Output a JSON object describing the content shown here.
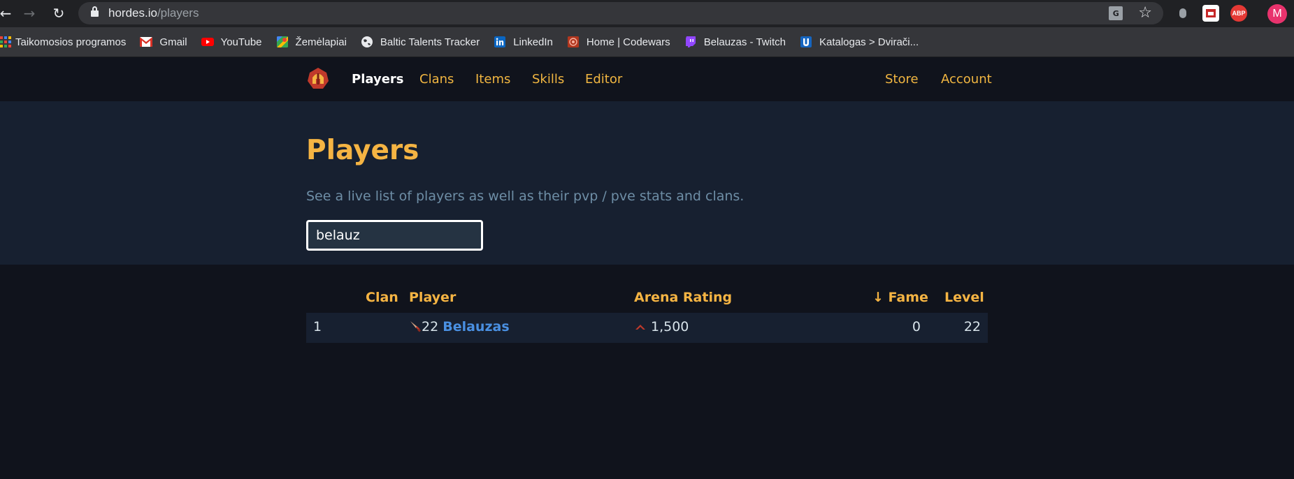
{
  "browser": {
    "url_host": "hordes.io",
    "url_path": "/players",
    "avatar_letter": "M",
    "abp_label": "ABP",
    "translate_label": "G",
    "bookmarks": [
      {
        "label": "Taikomosios programos",
        "icon": "apps-grid-icon"
      },
      {
        "label": "Gmail",
        "icon": "gmail-icon"
      },
      {
        "label": "YouTube",
        "icon": "youtube-icon"
      },
      {
        "label": "Žemėlapiai",
        "icon": "maps-icon"
      },
      {
        "label": "Baltic Talents Tracker",
        "icon": "globe-icon"
      },
      {
        "label": "LinkedIn",
        "icon": "linkedin-icon"
      },
      {
        "label": "Home | Codewars",
        "icon": "codewars-icon"
      },
      {
        "label": "Belauzas - Twitch",
        "icon": "twitch-icon"
      },
      {
        "label": "Katalogas > Dvirači...",
        "icon": "u-icon"
      }
    ]
  },
  "site": {
    "nav": {
      "players": "Players",
      "clans": "Clans",
      "items": "Items",
      "skills": "Skills",
      "editor": "Editor",
      "store": "Store",
      "account": "Account"
    },
    "colors": {
      "accent": "#f5b443",
      "link": "#4a90e2",
      "hero_bg": "#172030",
      "page_bg": "#10131c"
    }
  },
  "hero": {
    "title": "Players",
    "subtitle": "See a live list of players as well as their pvp / pve stats and clans.",
    "search_value": "belauz"
  },
  "table": {
    "headers": {
      "clan": "Clan",
      "player": "Player",
      "arena_rating": "Arena Rating",
      "fame": "↓ Fame",
      "level": "Level"
    },
    "rows": [
      {
        "rank": "1",
        "clan": "",
        "player_level": "22",
        "player_name": "Belauzas",
        "class_icon": "sword-icon",
        "arena_rating": "1,500",
        "rank_icon": "chevron-up-icon",
        "fame": "0",
        "level": "22"
      }
    ]
  }
}
